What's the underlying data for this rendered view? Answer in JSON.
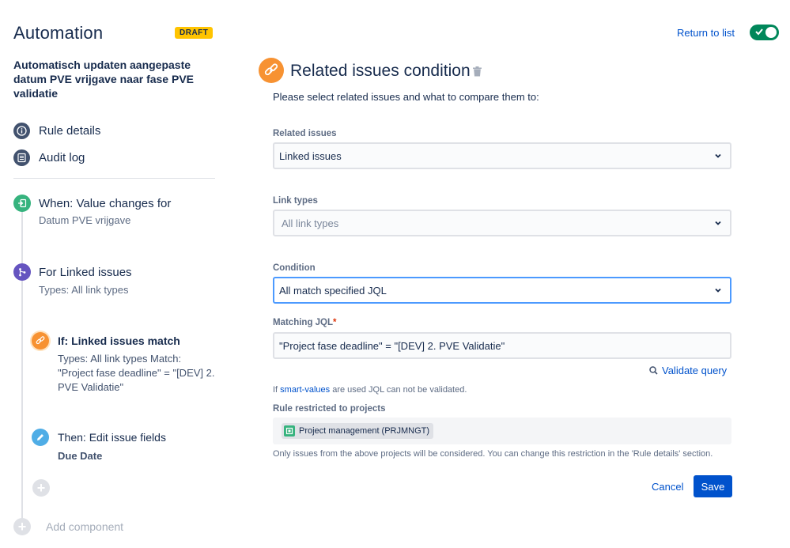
{
  "header": {
    "app_title": "Automation",
    "draft_badge": "DRAFT",
    "return_link": "Return to list",
    "enabled_toggle_on": true
  },
  "sidebar": {
    "rule_name": "Automatisch updaten aangepaste datum PVE vrijgave naar fase PVE validatie",
    "nav": [
      {
        "label": "Rule details",
        "icon": "info-icon"
      },
      {
        "label": "Audit log",
        "icon": "list-icon"
      }
    ],
    "steps": [
      {
        "title": "When: Value changes for",
        "subtitle": "Datum PVE vrijgave",
        "icon": "trigger-icon",
        "color": "#36b37e"
      },
      {
        "title": "For Linked issues",
        "subtitle": "Types: All link types",
        "icon": "branch-icon",
        "color": "#6554c0"
      },
      {
        "title": "If: Linked issues match",
        "subtitle": "Types: All link types Match: \"Project fase deadline\" = \"[DEV] 2. PVE Validatie\"",
        "icon": "link-icon",
        "color": "#f79232"
      },
      {
        "title": "Then: Edit issue fields",
        "subtitle": "Due Date",
        "icon": "pencil-icon",
        "color": "#4fade6"
      }
    ],
    "add_component": "Add component"
  },
  "panel": {
    "title": "Related issues condition",
    "description": "Please select related issues and what to compare them to:",
    "related_issues": {
      "label": "Related issues",
      "value": "Linked issues"
    },
    "link_types": {
      "label": "Link types",
      "placeholder": "All link types"
    },
    "condition": {
      "label": "Condition",
      "value": "All match specified JQL"
    },
    "matching_jql": {
      "label": "Matching JQL",
      "required_mark": "*",
      "value": "\"Project fase deadline\" = \"[DEV] 2. PVE Validatie\""
    },
    "validate_query": "Validate query",
    "note_prefix": "If ",
    "note_link": "smart-values",
    "note_suffix": " are used JQL can not be validated.",
    "restricted_label": "Rule restricted to projects",
    "project_tag": "Project management (PRJMNGT)",
    "footnote": "Only issues from the above projects will be considered. You can change this restriction in the 'Rule details' section.",
    "cancel": "Cancel",
    "save": "Save"
  },
  "colors": {
    "accent": "#0052cc",
    "toggle": "#00875a",
    "draft": "#ffc400",
    "condition_icon": "#f79232"
  }
}
